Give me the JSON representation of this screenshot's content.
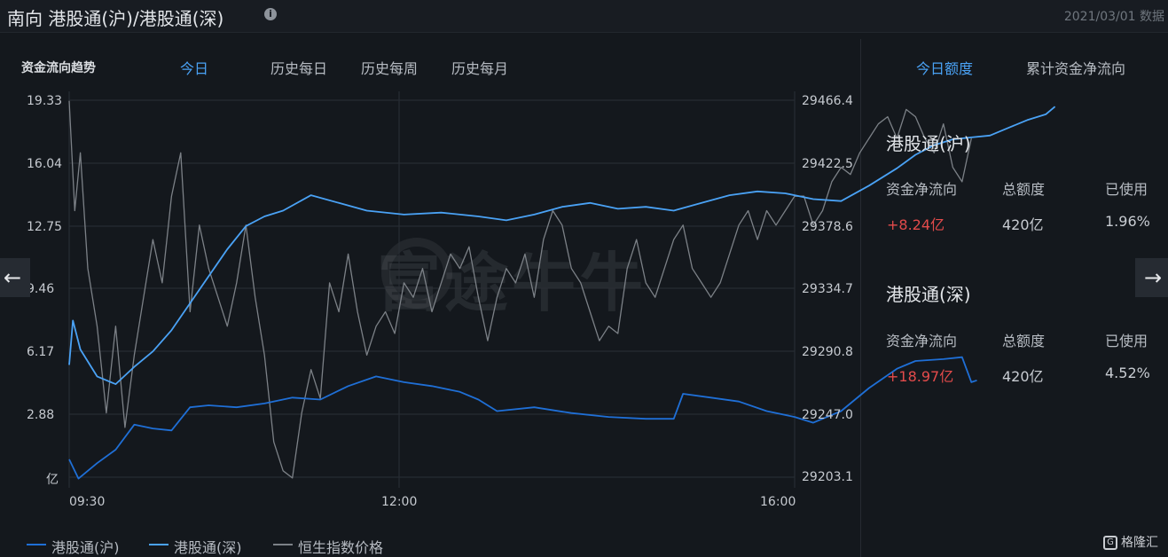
{
  "header": {
    "title": "南向 港股通(沪)/港股通(深)",
    "date": "2021/03/01 数据"
  },
  "tabs": {
    "title": "资金流向趋势",
    "items": [
      "今日",
      "历史每日",
      "历史每周",
      "历史每月"
    ],
    "active": 0
  },
  "right_panel": {
    "tabs": [
      "今日额度",
      "累计资金净流向"
    ],
    "active": 0,
    "sections": [
      {
        "title": "港股通(沪)",
        "headers": [
          "资金净流向",
          "总额度",
          "已使用"
        ],
        "values": [
          "+8.24亿",
          "420亿",
          "1.96%"
        ]
      },
      {
        "title": "港股通(深)",
        "headers": [
          "资金净流向",
          "总额度",
          "已使用"
        ],
        "values": [
          "+18.97亿",
          "420亿",
          "4.52%"
        ]
      }
    ]
  },
  "watermark": "富途牛牛",
  "brand": "格隆汇",
  "colors": {
    "sh": "#1f6fd6",
    "sz": "#4aa2f5",
    "hsi": "#7c8187",
    "accent": "#4aa2f5",
    "positive": "#e34b4b"
  },
  "chart_data": {
    "type": "line",
    "y_left": {
      "ticks": [
        "19.33",
        "16.04",
        "12.75",
        "9.46",
        "6.17",
        "2.88",
        "亿"
      ],
      "range": [
        -0.41,
        19.33
      ],
      "unit": "亿"
    },
    "y_right": {
      "ticks": [
        "29466.4",
        "29422.5",
        "29378.6",
        "29334.7",
        "29290.8",
        "29247.0",
        "29203.1"
      ],
      "range": [
        29203.1,
        29466.4
      ]
    },
    "x_ticks": [
      "09:30",
      "12:00",
      "16:00"
    ],
    "x_range_minutes": [
      570,
      960
    ],
    "grid": true,
    "legend": "bottom-left",
    "series": [
      {
        "name": "港股通(沪)",
        "axis": "left",
        "points": [
          [
            "09:30",
            0.7
          ],
          [
            "09:35",
            -0.3
          ],
          [
            "09:45",
            0.5
          ],
          [
            "09:55",
            1.2
          ],
          [
            "10:05",
            2.5
          ],
          [
            "10:15",
            2.3
          ],
          [
            "10:25",
            2.2
          ],
          [
            "10:35",
            3.4
          ],
          [
            "10:45",
            3.5
          ],
          [
            "11:00",
            3.4
          ],
          [
            "11:15",
            3.6
          ],
          [
            "11:30",
            3.9
          ],
          [
            "11:45",
            3.8
          ],
          [
            "12:00",
            4.5
          ],
          [
            "12:15",
            5.0
          ],
          [
            "12:30",
            4.7
          ],
          [
            "12:45",
            4.5
          ],
          [
            "13:00",
            4.2
          ],
          [
            "13:10",
            3.8
          ],
          [
            "13:20",
            3.2
          ],
          [
            "13:40",
            3.4
          ],
          [
            "14:00",
            3.1
          ],
          [
            "14:20",
            2.9
          ],
          [
            "14:40",
            2.8
          ],
          [
            "14:55",
            2.8
          ],
          [
            "15:00",
            4.1
          ],
          [
            "15:15",
            3.9
          ],
          [
            "15:30",
            3.7
          ],
          [
            "15:45",
            3.2
          ],
          [
            "16:00",
            2.9
          ],
          [
            "16:10",
            2.6
          ],
          [
            "16:25",
            3.2
          ],
          [
            "16:40",
            4.4
          ],
          [
            "16:55",
            5.4
          ],
          [
            "17:05",
            5.8
          ],
          [
            "17:20",
            5.9
          ],
          [
            "17:30",
            6.0
          ],
          [
            "17:35",
            4.7
          ],
          [
            "17:38",
            4.8
          ]
        ]
      },
      {
        "name": "港股通(深)",
        "axis": "left",
        "points": [
          [
            "09:30",
            5.6
          ],
          [
            "09:32",
            7.9
          ],
          [
            "09:36",
            6.4
          ],
          [
            "09:45",
            5.0
          ],
          [
            "09:55",
            4.6
          ],
          [
            "10:05",
            5.5
          ],
          [
            "10:15",
            6.3
          ],
          [
            "10:25",
            7.4
          ],
          [
            "10:40",
            9.5
          ],
          [
            "10:55",
            11.6
          ],
          [
            "11:05",
            12.8
          ],
          [
            "11:15",
            13.3
          ],
          [
            "11:25",
            13.6
          ],
          [
            "11:40",
            14.4
          ],
          [
            "11:55",
            14.0
          ],
          [
            "12:10",
            13.6
          ],
          [
            "12:30",
            13.4
          ],
          [
            "12:50",
            13.5
          ],
          [
            "13:10",
            13.3
          ],
          [
            "13:25",
            13.1
          ],
          [
            "13:40",
            13.4
          ],
          [
            "13:55",
            13.8
          ],
          [
            "14:10",
            14.0
          ],
          [
            "14:25",
            13.7
          ],
          [
            "14:40",
            13.8
          ],
          [
            "14:55",
            13.6
          ],
          [
            "15:10",
            14.0
          ],
          [
            "15:25",
            14.4
          ],
          [
            "15:40",
            14.6
          ],
          [
            "15:55",
            14.5
          ],
          [
            "16:10",
            14.2
          ],
          [
            "16:25",
            14.1
          ],
          [
            "16:40",
            14.9
          ],
          [
            "16:55",
            15.8
          ],
          [
            "17:05",
            16.5
          ],
          [
            "17:15",
            17.0
          ],
          [
            "17:25",
            17.3
          ],
          [
            "17:35",
            17.4
          ],
          [
            "17:45",
            17.5
          ],
          [
            "17:55",
            17.9
          ],
          [
            "18:05",
            18.3
          ],
          [
            "18:15",
            18.6
          ],
          [
            "18:20",
            19.0
          ]
        ]
      },
      {
        "name": "恒生指数价格",
        "axis": "right",
        "points": [
          [
            "09:30",
            29466
          ],
          [
            "09:33",
            29390
          ],
          [
            "09:36",
            29430
          ],
          [
            "09:40",
            29350
          ],
          [
            "09:45",
            29310
          ],
          [
            "09:50",
            29250
          ],
          [
            "09:55",
            29310
          ],
          [
            "10:00",
            29240
          ],
          [
            "10:05",
            29290
          ],
          [
            "10:10",
            29330
          ],
          [
            "10:15",
            29370
          ],
          [
            "10:20",
            29340
          ],
          [
            "10:25",
            29400
          ],
          [
            "10:30",
            29430
          ],
          [
            "10:35",
            29320
          ],
          [
            "10:40",
            29380
          ],
          [
            "10:45",
            29350
          ],
          [
            "10:50",
            29330
          ],
          [
            "10:55",
            29310
          ],
          [
            "11:00",
            29340
          ],
          [
            "11:05",
            29380
          ],
          [
            "11:10",
            29330
          ],
          [
            "11:15",
            29290
          ],
          [
            "11:20",
            29230
          ],
          [
            "11:25",
            29210
          ],
          [
            "11:30",
            29205
          ],
          [
            "11:35",
            29250
          ],
          [
            "11:40",
            29280
          ],
          [
            "11:45",
            29260
          ],
          [
            "11:50",
            29340
          ],
          [
            "11:55",
            29320
          ],
          [
            "12:00",
            29360
          ],
          [
            "12:05",
            29320
          ],
          [
            "12:10",
            29290
          ],
          [
            "12:15",
            29310
          ],
          [
            "12:20",
            29320
          ],
          [
            "12:25",
            29305
          ],
          [
            "12:30",
            29340
          ],
          [
            "12:35",
            29330
          ],
          [
            "12:40",
            29350
          ],
          [
            "12:45",
            29320
          ],
          [
            "12:50",
            29340
          ],
          [
            "12:55",
            29360
          ],
          [
            "13:00",
            29350
          ],
          [
            "13:05",
            29365
          ],
          [
            "13:10",
            29330
          ],
          [
            "13:15",
            29300
          ],
          [
            "13:20",
            29330
          ],
          [
            "13:25",
            29350
          ],
          [
            "13:30",
            29340
          ],
          [
            "13:35",
            29360
          ],
          [
            "13:40",
            29330
          ],
          [
            "13:45",
            29370
          ],
          [
            "13:50",
            29390
          ],
          [
            "13:55",
            29380
          ],
          [
            "14:00",
            29350
          ],
          [
            "14:05",
            29340
          ],
          [
            "14:10",
            29320
          ],
          [
            "14:15",
            29300
          ],
          [
            "14:20",
            29310
          ],
          [
            "14:25",
            29305
          ],
          [
            "14:30",
            29350
          ],
          [
            "14:35",
            29370
          ],
          [
            "14:40",
            29340
          ],
          [
            "14:45",
            29330
          ],
          [
            "14:50",
            29350
          ],
          [
            "14:55",
            29370
          ],
          [
            "15:00",
            29380
          ],
          [
            "15:05",
            29350
          ],
          [
            "15:10",
            29340
          ],
          [
            "15:15",
            29330
          ],
          [
            "15:20",
            29340
          ],
          [
            "15:25",
            29360
          ],
          [
            "15:30",
            29380
          ],
          [
            "15:35",
            29390
          ],
          [
            "15:40",
            29370
          ],
          [
            "15:45",
            29390
          ],
          [
            "15:50",
            29380
          ],
          [
            "15:55",
            29390
          ],
          [
            "16:00",
            29400
          ],
          [
            "16:05",
            29400
          ],
          [
            "16:10",
            29380
          ],
          [
            "16:15",
            29390
          ],
          [
            "16:20",
            29410
          ],
          [
            "16:25",
            29420
          ],
          [
            "16:30",
            29415
          ],
          [
            "16:35",
            29430
          ],
          [
            "16:40",
            29440
          ],
          [
            "16:45",
            29450
          ],
          [
            "16:50",
            29455
          ],
          [
            "16:55",
            29440
          ],
          [
            "17:00",
            29460
          ],
          [
            "17:05",
            29455
          ],
          [
            "17:10",
            29440
          ],
          [
            "17:15",
            29430
          ],
          [
            "17:20",
            29450
          ],
          [
            "17:25",
            29420
          ],
          [
            "17:30",
            29410
          ],
          [
            "17:35",
            29440
          ]
        ]
      }
    ]
  }
}
